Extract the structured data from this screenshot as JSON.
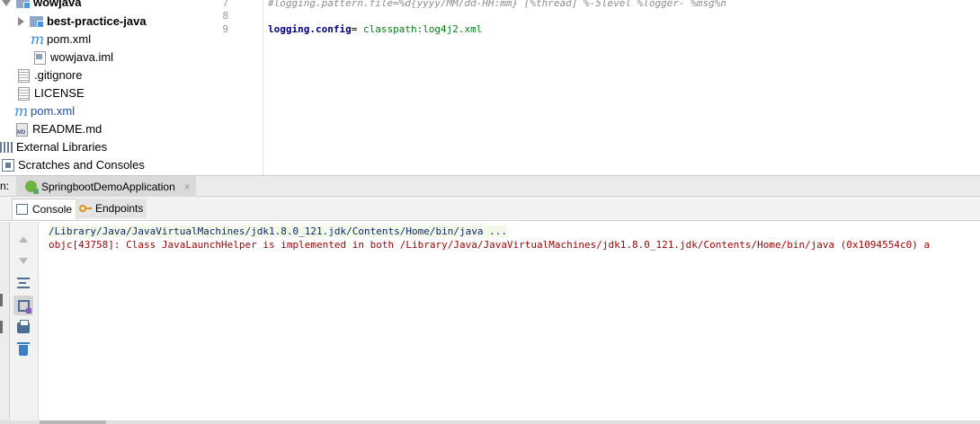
{
  "project_tree": {
    "items": [
      {
        "label": "wowjava"
      },
      {
        "label": "best-practice-java"
      },
      {
        "label": "pom.xml"
      },
      {
        "label": "wowjava.iml"
      },
      {
        "label": ".gitignore"
      },
      {
        "label": "LICENSE"
      },
      {
        "label": "pom.xml"
      },
      {
        "label": "README.md"
      },
      {
        "label": "External Libraries"
      },
      {
        "label": "Scratches and Consoles"
      }
    ]
  },
  "editor": {
    "line_numbers": [
      "7",
      "8",
      "9"
    ],
    "lines": [
      {
        "comment": "#logging.pattern.file=%d{yyyy/MM/dd-HH:mm} [%thread] %-5level %logger- %msg%n"
      },
      {
        "comment": ""
      },
      {
        "key": "logging.config",
        "sep": "=",
        "value": " classpath:log4j2.xml"
      }
    ]
  },
  "run_panel": {
    "label": "n:",
    "run_tab": "SpringbootDemoApplication",
    "close_glyph": "×",
    "tabs": {
      "console": "Console",
      "endpoints": "Endpoints"
    }
  },
  "console": {
    "lines": [
      "/Library/Java/JavaVirtualMachines/jdk1.8.0_121.jdk/Contents/Home/bin/java ...",
      "objc[43758]: Class JavaLaunchHelper is implemented in both /Library/Java/JavaVirtualMachines/jdk1.8.0_121.jdk/Contents/Home/bin/java (0x1094554c0) a"
    ]
  },
  "icons": {
    "maven": "m"
  },
  "colors": {
    "spring_green": "#6db33f",
    "error_red": "#9e0000",
    "command_blue": "#0a2a66",
    "property_key": "#000080",
    "property_value": "#067d17"
  }
}
